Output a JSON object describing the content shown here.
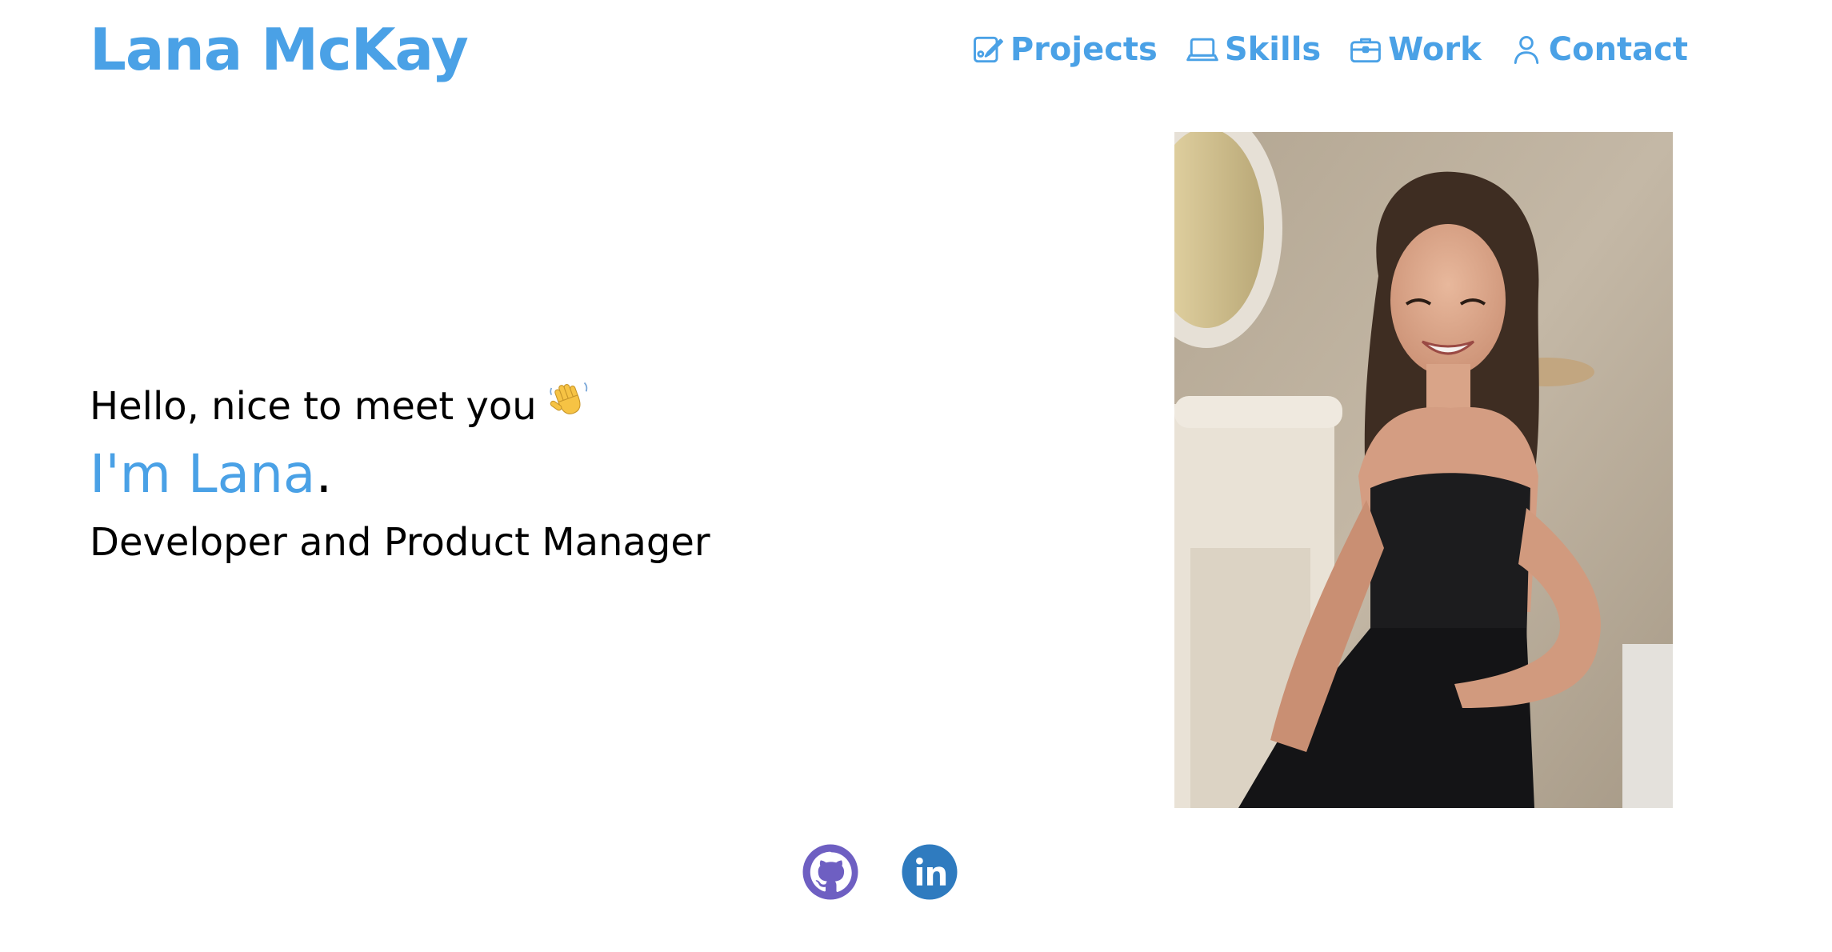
{
  "header": {
    "site_name": "Lana McKay",
    "nav": [
      {
        "label": "Projects",
        "icon": "edit-note-icon"
      },
      {
        "label": "Skills",
        "icon": "laptop-icon"
      },
      {
        "label": "Work",
        "icon": "briefcase-icon"
      },
      {
        "label": "Contact",
        "icon": "person-icon"
      }
    ]
  },
  "hero": {
    "greeting": "Hello, nice to meet you",
    "greeting_emoji": "👋",
    "intro_name": "I'm Lana",
    "intro_punct": ".",
    "role": "Developer and Product Manager"
  },
  "portrait": {
    "alt": "portrait-photo"
  },
  "social": [
    {
      "name": "github-icon",
      "color": "#6e5fc2"
    },
    {
      "name": "linkedin-icon",
      "color": "#2f7bbf"
    }
  ],
  "colors": {
    "accent": "#4aa1e6",
    "text": "#000000",
    "background": "#ffffff"
  }
}
